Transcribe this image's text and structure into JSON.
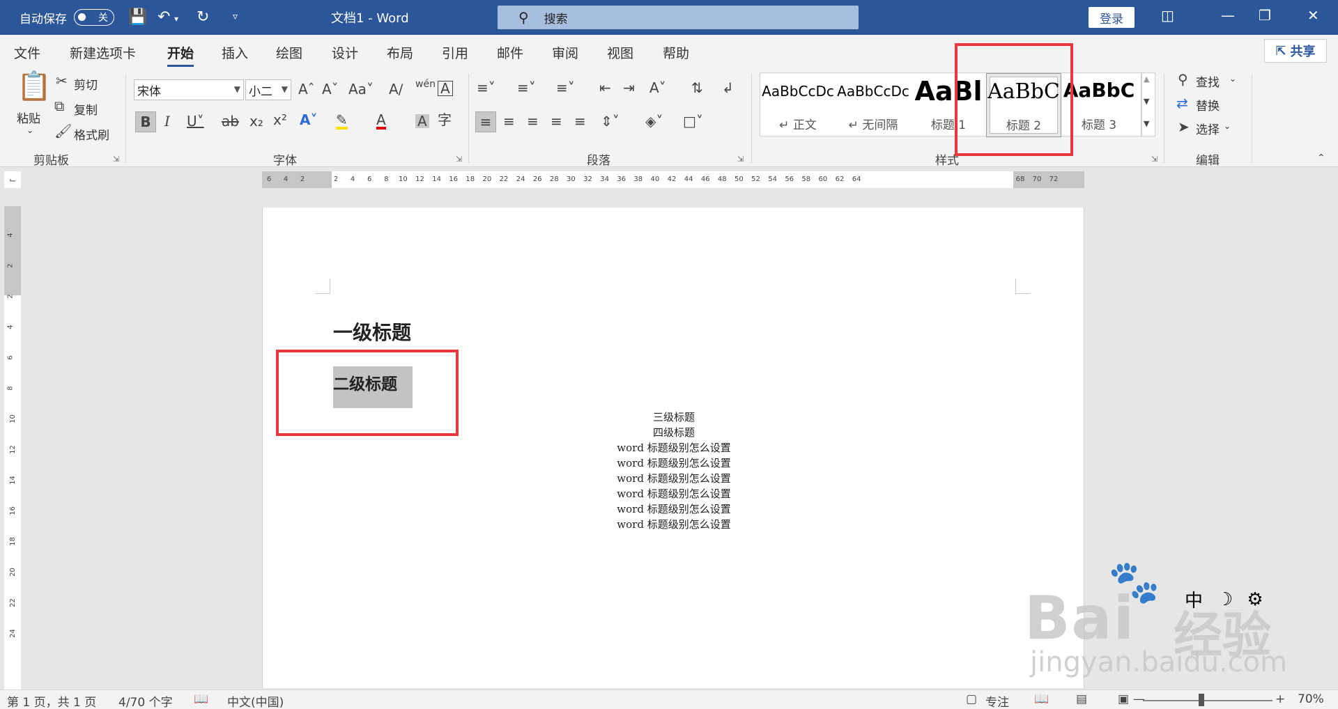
{
  "titlebar": {
    "autosave_label": "自动保存",
    "autosave_state": "关",
    "doc_title": "文档1  -  Word",
    "search_placeholder": "搜索",
    "login": "登录"
  },
  "tabs": [
    "文件",
    "新建选项卡",
    "开始",
    "插入",
    "绘图",
    "设计",
    "布局",
    "引用",
    "邮件",
    "审阅",
    "视图",
    "帮助"
  ],
  "active_tab": "开始",
  "share": "共享",
  "ribbon": {
    "clipboard": {
      "label": "剪贴板",
      "paste": "粘贴",
      "cut": "剪切",
      "copy": "复制",
      "format_painter": "格式刷"
    },
    "font": {
      "label": "字体",
      "font_name": "宋体",
      "font_size": "小二"
    },
    "paragraph": {
      "label": "段落"
    },
    "styles": {
      "label": "样式",
      "items": [
        {
          "preview": "AaBbCcDc",
          "name": "↵ 正文"
        },
        {
          "preview": "AaBbCcDc",
          "name": "↵ 无间隔"
        },
        {
          "preview": "AaBl",
          "name": "标题 1"
        },
        {
          "preview": "AaBbC",
          "name": "标题 2"
        },
        {
          "preview": "AaBbC",
          "name": "标题 3"
        }
      ]
    },
    "editing": {
      "label": "编辑",
      "find": "查找",
      "replace": "替换",
      "select": "选择"
    }
  },
  "ruler": {
    "h_numbers": [
      "6",
      "4",
      "2",
      "2",
      "4",
      "6",
      "8",
      "10",
      "12",
      "14",
      "16",
      "18",
      "20",
      "22",
      "24",
      "26",
      "28",
      "30",
      "32",
      "34",
      "36",
      "38",
      "40",
      "42",
      "44",
      "46",
      "48",
      "50",
      "52",
      "54",
      "56",
      "58",
      "60",
      "62",
      "64",
      "68",
      "70",
      "72"
    ],
    "v_numbers": [
      "4",
      "2",
      "2",
      "4",
      "6",
      "8",
      "10",
      "12",
      "14",
      "16",
      "18",
      "20",
      "22",
      "24"
    ]
  },
  "document": {
    "heading1": "一级标题",
    "heading2": "二级标题",
    "lines": [
      "三级标题",
      "四级标题",
      "word 标题级别怎么设置",
      "word 标题级别怎么设置",
      "word 标题级别怎么设置",
      "word 标题级别怎么设置",
      "word 标题级别怎么设置",
      "word 标题级别怎么设置"
    ]
  },
  "watermark": {
    "brand": "Bai",
    "brand2": "经验",
    "url": "jingyan.baidu.com"
  },
  "ime": {
    "mode": "中"
  },
  "statusbar": {
    "page": "第 1 页，共 1 页",
    "words": "4/70 个字",
    "language": "中文(中国)",
    "focus": "专注",
    "zoom": "70%"
  },
  "colors": {
    "titlebar": "#2b579a",
    "highlight": "#e8373d"
  }
}
